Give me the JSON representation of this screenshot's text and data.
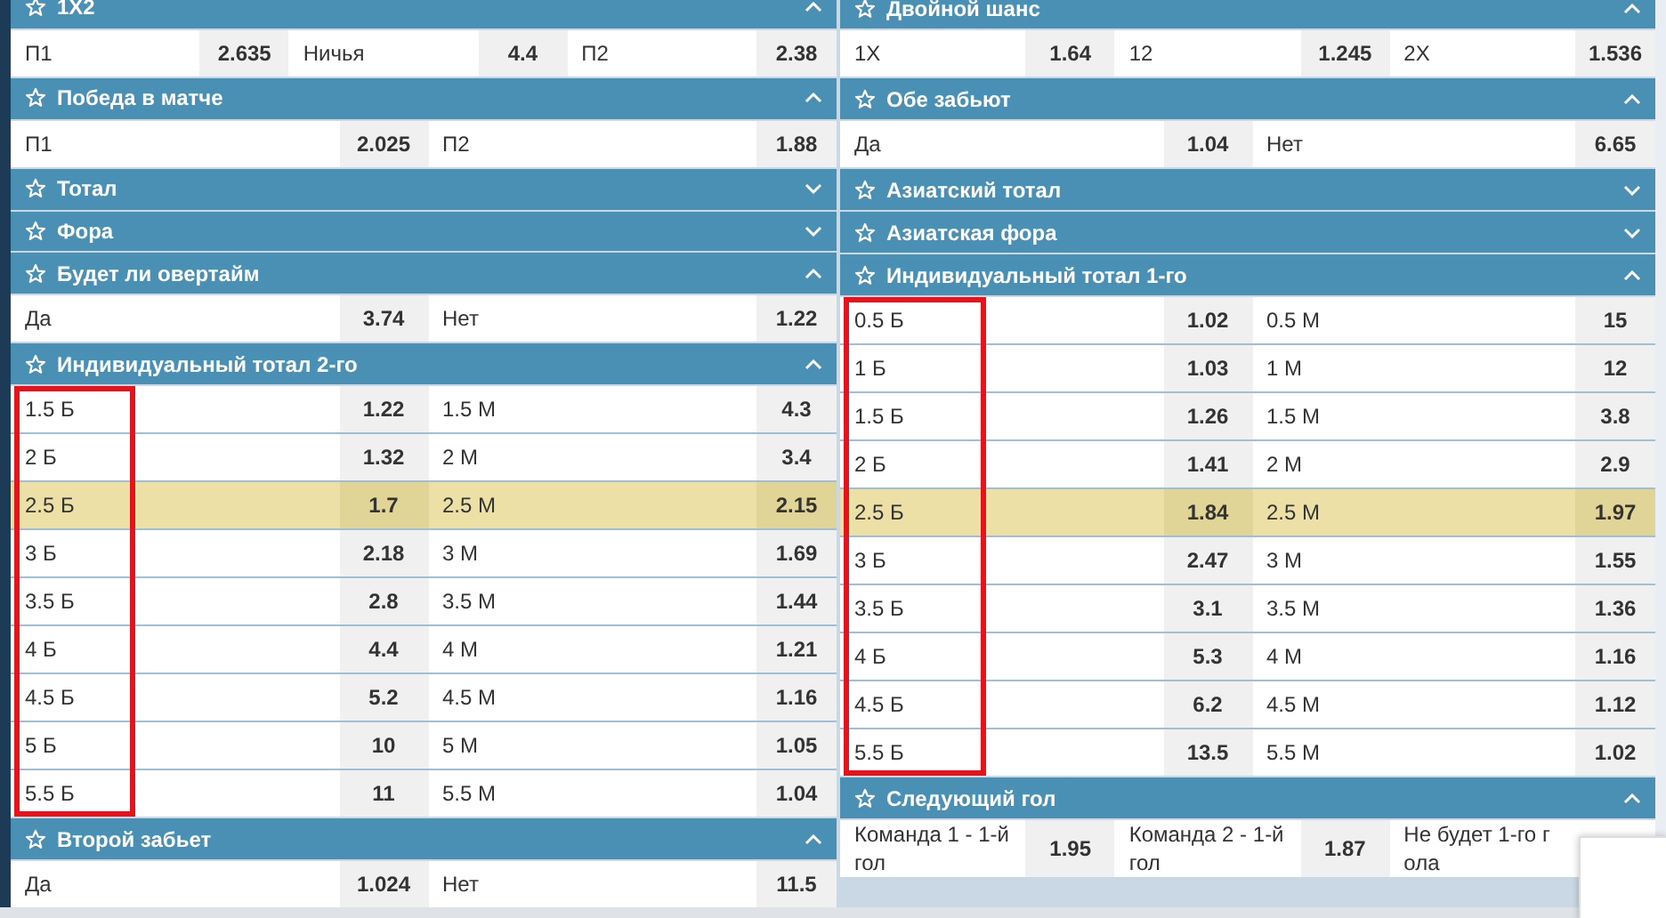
{
  "columns": [
    {
      "markets": [
        {
          "title": "1X2",
          "expanded": true,
          "rows": [
            {
              "selected": false,
              "cells": [
                {
                  "label": "П1",
                  "odds": "2.635"
                },
                {
                  "label": "Ничья",
                  "odds": "4.4"
                },
                {
                  "label": "П2",
                  "odds": "2.38"
                }
              ]
            }
          ]
        },
        {
          "title": "Победа в матче",
          "expanded": true,
          "rows": [
            {
              "selected": false,
              "cells": [
                {
                  "label": "П1",
                  "odds": "2.025"
                },
                {
                  "label": "П2",
                  "odds": "1.88"
                }
              ]
            }
          ]
        },
        {
          "title": "Тотал",
          "expanded": false
        },
        {
          "title": "Фора",
          "expanded": false
        },
        {
          "title": "Будет ли овертайм",
          "expanded": true,
          "rows": [
            {
              "selected": false,
              "cells": [
                {
                  "label": "Да",
                  "odds": "3.74"
                },
                {
                  "label": "Нет",
                  "odds": "1.22"
                }
              ]
            }
          ]
        },
        {
          "title": "Индивидуальный тотал 2-го",
          "expanded": true,
          "outlined": true,
          "rows": [
            {
              "selected": false,
              "cells": [
                {
                  "label": "1.5 Б",
                  "odds": "1.22"
                },
                {
                  "label": "1.5 М",
                  "odds": "4.3"
                }
              ]
            },
            {
              "selected": false,
              "cells": [
                {
                  "label": "2 Б",
                  "odds": "1.32"
                },
                {
                  "label": "2 М",
                  "odds": "3.4"
                }
              ]
            },
            {
              "selected": true,
              "cells": [
                {
                  "label": "2.5 Б",
                  "odds": "1.7"
                },
                {
                  "label": "2.5 М",
                  "odds": "2.15"
                }
              ]
            },
            {
              "selected": false,
              "cells": [
                {
                  "label": "3 Б",
                  "odds": "2.18"
                },
                {
                  "label": "3 М",
                  "odds": "1.69"
                }
              ]
            },
            {
              "selected": false,
              "cells": [
                {
                  "label": "3.5 Б",
                  "odds": "2.8"
                },
                {
                  "label": "3.5 М",
                  "odds": "1.44"
                }
              ]
            },
            {
              "selected": false,
              "cells": [
                {
                  "label": "4 Б",
                  "odds": "4.4"
                },
                {
                  "label": "4 М",
                  "odds": "1.21"
                }
              ]
            },
            {
              "selected": false,
              "cells": [
                {
                  "label": "4.5 Б",
                  "odds": "5.2"
                },
                {
                  "label": "4.5 М",
                  "odds": "1.16"
                }
              ]
            },
            {
              "selected": false,
              "cells": [
                {
                  "label": "5 Б",
                  "odds": "10"
                },
                {
                  "label": "5 М",
                  "odds": "1.05"
                }
              ]
            },
            {
              "selected": false,
              "cells": [
                {
                  "label": "5.5 Б",
                  "odds": "11"
                },
                {
                  "label": "5.5 М",
                  "odds": "1.04"
                }
              ]
            }
          ]
        },
        {
          "title": "Второй забьет",
          "expanded": true,
          "rows": [
            {
              "selected": false,
              "cells": [
                {
                  "label": "Да",
                  "odds": "1.024"
                },
                {
                  "label": "Нет",
                  "odds": "11.5"
                }
              ]
            }
          ]
        }
      ]
    },
    {
      "markets": [
        {
          "title": "Двойной шанс",
          "expanded": true,
          "rows": [
            {
              "selected": false,
              "cells": [
                {
                  "label": "1X",
                  "odds": "1.64"
                },
                {
                  "label": "12",
                  "odds": "1.245"
                },
                {
                  "label": "2X",
                  "odds": "1.536"
                }
              ]
            }
          ]
        },
        {
          "title": "Обе забьют",
          "expanded": true,
          "rows": [
            {
              "selected": false,
              "cells": [
                {
                  "label": "Да",
                  "odds": "1.04"
                },
                {
                  "label": "Нет",
                  "odds": "6.65"
                }
              ]
            }
          ]
        },
        {
          "title": "Азиатский тотал",
          "expanded": false
        },
        {
          "title": "Азиатская фора",
          "expanded": false
        },
        {
          "title": "Индивидуальный тотал 1-го",
          "expanded": true,
          "outlined": true,
          "rows": [
            {
              "selected": false,
              "cells": [
                {
                  "label": "0.5 Б",
                  "odds": "1.02"
                },
                {
                  "label": "0.5 М",
                  "odds": "15"
                }
              ]
            },
            {
              "selected": false,
              "cells": [
                {
                  "label": "1 Б",
                  "odds": "1.03"
                },
                {
                  "label": "1 М",
                  "odds": "12"
                }
              ]
            },
            {
              "selected": false,
              "cells": [
                {
                  "label": "1.5 Б",
                  "odds": "1.26"
                },
                {
                  "label": "1.5 М",
                  "odds": "3.8"
                }
              ]
            },
            {
              "selected": false,
              "cells": [
                {
                  "label": "2 Б",
                  "odds": "1.41"
                },
                {
                  "label": "2 М",
                  "odds": "2.9"
                }
              ]
            },
            {
              "selected": true,
              "cells": [
                {
                  "label": "2.5 Б",
                  "odds": "1.84"
                },
                {
                  "label": "2.5 М",
                  "odds": "1.97"
                }
              ]
            },
            {
              "selected": false,
              "cells": [
                {
                  "label": "3 Б",
                  "odds": "2.47"
                },
                {
                  "label": "3 М",
                  "odds": "1.55"
                }
              ]
            },
            {
              "selected": false,
              "cells": [
                {
                  "label": "3.5 Б",
                  "odds": "3.1"
                },
                {
                  "label": "3.5 М",
                  "odds": "1.36"
                }
              ]
            },
            {
              "selected": false,
              "cells": [
                {
                  "label": "4 Б",
                  "odds": "5.3"
                },
                {
                  "label": "4 М",
                  "odds": "1.16"
                }
              ]
            },
            {
              "selected": false,
              "cells": [
                {
                  "label": "4.5 Б",
                  "odds": "6.2"
                },
                {
                  "label": "4.5 М",
                  "odds": "1.12"
                }
              ]
            },
            {
              "selected": false,
              "cells": [
                {
                  "label": "5.5 Б",
                  "odds": "13.5"
                },
                {
                  "label": "5.5 М",
                  "odds": "1.02"
                }
              ]
            }
          ]
        },
        {
          "title": "Следующий гол",
          "expanded": true,
          "rows": [
            {
              "selected": false,
              "cells": [
                {
                  "label": "Команда 1 - 1-й гол",
                  "odds": "1.95"
                },
                {
                  "label": "Команда 2 - 1-й гол",
                  "odds": "1.87"
                },
                {
                  "label": "Не будет 1-го гола"
                }
              ]
            }
          ]
        }
      ]
    }
  ]
}
